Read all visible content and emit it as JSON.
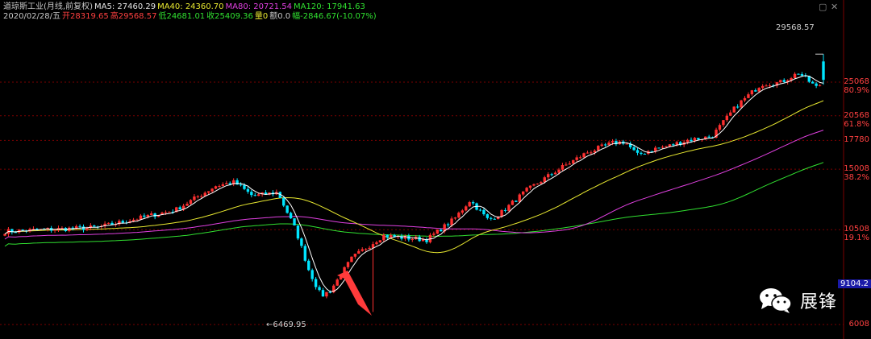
{
  "header": {
    "line1": [
      {
        "text": "道琼斯工业(月线,前复权)",
        "color": "#c8c8c8"
      },
      {
        "text": "MA5: 27460.29",
        "color": "#e6e6e6"
      },
      {
        "text": "MA40: 24360.70",
        "color": "#e8e830"
      },
      {
        "text": "MA80: 20721.54",
        "color": "#e040e0"
      },
      {
        "text": "MA120: 17941.63",
        "color": "#30e030"
      }
    ],
    "line2": [
      {
        "text": "2020/02/28/五",
        "color": "#c8c8c8"
      },
      {
        "text": "开28319.65",
        "color": "#ff4040"
      },
      {
        "text": "高29568.57",
        "color": "#ff4040"
      },
      {
        "text": "低24681.01",
        "color": "#30e030"
      },
      {
        "text": "收25409.36",
        "color": "#30e030"
      },
      {
        "text": "量0",
        "color": "#e8e830"
      },
      {
        "text": "额0.0",
        "color": "#c8c8c8"
      },
      {
        "text": "幅-2846.67(-10.07%)",
        "color": "#30e030"
      }
    ]
  },
  "corner_icons": [
    "square-icon",
    "close-icon"
  ],
  "axis": {
    "price_labels": [
      {
        "value": 25068,
        "text": "25068",
        "sub": "80.9%"
      },
      {
        "value": 20568,
        "text": "20568",
        "sub": "61.8%"
      },
      {
        "value": 17780,
        "text": "17780",
        "sub": ""
      },
      {
        "value": 15008,
        "text": "15008",
        "sub": "38.2%"
      },
      {
        "value": 10508,
        "text": "10508",
        "sub": "19.1%"
      },
      {
        "value": 6008,
        "text": "6008",
        "sub": ""
      }
    ],
    "current_price": "9104.2"
  },
  "annotations": {
    "high_label": "29568.57",
    "low_label": "6469.95"
  },
  "watermark": {
    "text": "展锋",
    "icon": "wechat-icon"
  },
  "colors": {
    "up": "#ff3030",
    "down": "#00e5ff",
    "grid": "#7a0000",
    "ma5": "#ffffff",
    "ma40": "#e8e830",
    "ma80": "#e040e0",
    "ma120": "#30e030",
    "arrow": "#ff3b3b"
  },
  "chart_data": {
    "type": "candlestick",
    "title": "道琼斯工业(月线,前复权)",
    "y_scale": "log",
    "ylim": [
      6008,
      29800
    ],
    "x_range": [
      "2001",
      "2020-02"
    ],
    "ma_periods": [
      5,
      40,
      80,
      120
    ],
    "ma_latest": {
      "MA5": 27460.29,
      "MA40": 24360.7,
      "MA80": 20721.54,
      "MA120": 17941.63
    },
    "last_bar": {
      "date": "2020/02/28",
      "open": 28319.65,
      "high": 29568.57,
      "low": 24681.01,
      "close": 25409.36
    },
    "extremes": {
      "max": 29568.57,
      "min": 6469.95
    }
  }
}
